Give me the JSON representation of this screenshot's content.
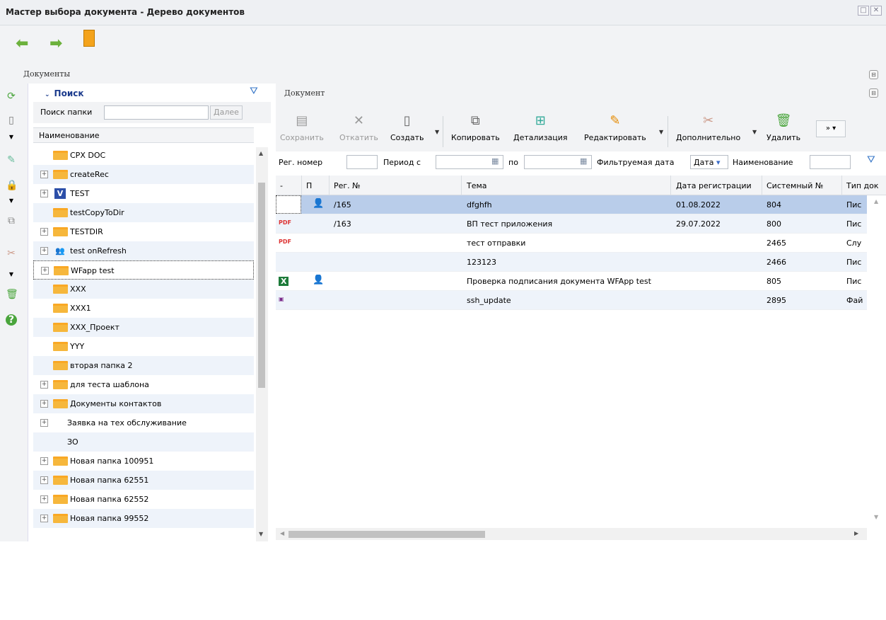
{
  "window": {
    "title": "Мастер выбора документа - Дерево документов"
  },
  "panels": {
    "documents": "Документы",
    "document": "Документ"
  },
  "tree": {
    "search_header": "Поиск",
    "search_label": "Поиск папки",
    "search_value": "",
    "next_button": "Далее",
    "column_header": "Наименование",
    "items": [
      {
        "label": "CPX DOC",
        "icon": "folder-special-icon",
        "expandable": false
      },
      {
        "label": "createRec",
        "icon": "folder-icon",
        "expandable": true
      },
      {
        "label": "TEST",
        "icon": "v-app-icon",
        "expandable": true
      },
      {
        "label": "testCopyToDir",
        "icon": "folder-icon",
        "expandable": false
      },
      {
        "label": "TESTDIR",
        "icon": "folder-icon",
        "expandable": true
      },
      {
        "label": "test onRefresh",
        "icon": "users-icon",
        "expandable": true
      },
      {
        "label": "WFapp test",
        "icon": "folder-icon",
        "expandable": true
      },
      {
        "label": "XXX",
        "icon": "folder-icon",
        "expandable": false
      },
      {
        "label": "XXX1",
        "icon": "folder-icon",
        "expandable": false
      },
      {
        "label": "XXX_Проект",
        "icon": "folder-icon",
        "expandable": false
      },
      {
        "label": "YYY",
        "icon": "folder-icon",
        "expandable": false
      },
      {
        "label": "вторая папка 2",
        "icon": "folder-icon",
        "expandable": false
      },
      {
        "label": "для теста шаблона",
        "icon": "folder-icon",
        "expandable": true
      },
      {
        "label": "Документы контактов",
        "icon": "folder-icon",
        "expandable": true
      },
      {
        "label": "Заявка на тех обслуживание",
        "icon": "",
        "expandable": true
      },
      {
        "label": "ЗО",
        "icon": "",
        "expandable": false
      },
      {
        "label": "Новая папка 100951",
        "icon": "folder-icon",
        "expandable": true
      },
      {
        "label": "Новая папка 62551",
        "icon": "folder-icon",
        "expandable": true
      },
      {
        "label": "Новая папка 62552",
        "icon": "folder-icon",
        "expandable": true
      },
      {
        "label": "Новая папка 99552",
        "icon": "folder-icon",
        "expandable": true
      }
    ]
  },
  "toolbar": {
    "save": "Сохранить",
    "rollback": "Откатить",
    "create": "Создать",
    "copy": "Копировать",
    "detail": "Детализация",
    "edit": "Редактировать",
    "more": "Дополнительно",
    "delete": "Удалить",
    "overflow": "»"
  },
  "filter": {
    "reg_number": "Рег. номер",
    "period_from": "Период с",
    "to": "по",
    "filter_date": "Фильтруемая дата",
    "date_select": "Дата",
    "name": "Наименование"
  },
  "grid": {
    "columns": [
      "-",
      "П",
      "Рег. №",
      "Тема",
      "Дата регистрации",
      "Системный №",
      "Тип док"
    ],
    "rows": [
      {
        "icon": "",
        "p": "user",
        "reg": "/165",
        "topic": "dfghfh",
        "date": "01.08.2022",
        "sys": "804",
        "type": "Пис"
      },
      {
        "icon": "pdf",
        "p": "",
        "reg": "/163",
        "topic": "ВП тест приложения",
        "date": "29.07.2022",
        "sys": "800",
        "type": "Пис"
      },
      {
        "icon": "pdf",
        "p": "",
        "reg": "",
        "topic": "тест отправки",
        "date": "",
        "sys": "2465",
        "type": "Слу"
      },
      {
        "icon": "",
        "p": "",
        "reg": "",
        "topic": "123123",
        "date": "",
        "sys": "2466",
        "type": "Пис"
      },
      {
        "icon": "xls",
        "p": "user",
        "reg": "",
        "topic": "Проверка подписания документа WFApp test",
        "date": "",
        "sys": "805",
        "type": "Пис"
      },
      {
        "icon": "img",
        "p": "",
        "reg": "",
        "topic": "ssh_update",
        "date": "",
        "sys": "2895",
        "type": "Фай"
      }
    ]
  },
  "colors": {
    "folder": "#f6b73c",
    "selected_row": "#b9cdea",
    "alt_row": "#eef3fa",
    "nav_arrow": "#6cb13c",
    "search_blue": "#1a3a8c"
  }
}
